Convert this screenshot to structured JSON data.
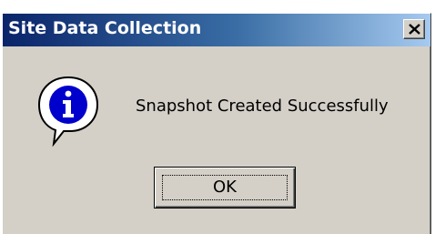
{
  "dialog": {
    "title": "Site Data Collection",
    "message": "Snapshot Created Successfully",
    "ok_label": "OK",
    "icon": "info-icon",
    "close_icon": "close-icon"
  },
  "colors": {
    "titlebar_start": "#0a246a",
    "titlebar_end": "#a6caf0",
    "face": "#d4d0c8",
    "info_blue": "#0000cc"
  }
}
